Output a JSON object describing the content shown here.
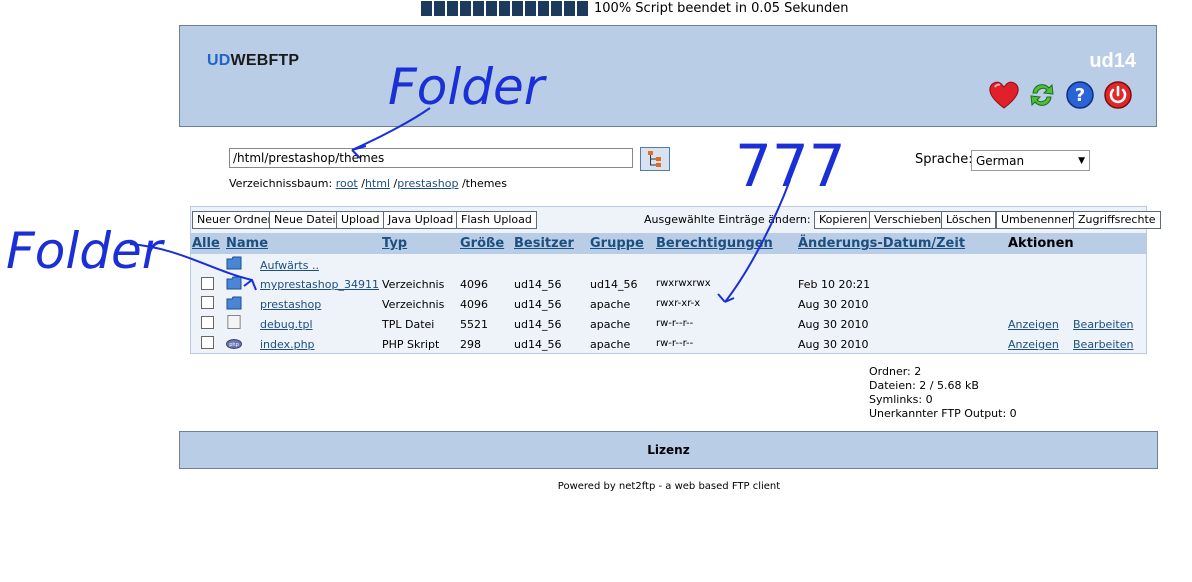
{
  "status": {
    "text": "100% Script beendet in 0.05 Sekunden",
    "progress_percent": 100,
    "segments": 13
  },
  "header": {
    "logo_prefix": "UD",
    "logo_suffix": "WEBFTP",
    "user": "ud14",
    "icons": [
      "heart-icon",
      "refresh-icon",
      "help-icon",
      "power-icon"
    ]
  },
  "path": {
    "value": "/html/prestashop/themes"
  },
  "language": {
    "label": "Sprache:",
    "selected": "German"
  },
  "breadcrumb": {
    "label": "Verzeichnissbaum:",
    "root": "root",
    "sep1": " /",
    "html": "html",
    "sep2": " /",
    "prestashop": "prestashop",
    "tail": " /themes"
  },
  "toolbar": {
    "new_folder": "Neuer Ordner",
    "new_file": "Neue Datei",
    "upload": "Upload",
    "java_upload": "Java Upload",
    "flash_upload": "Flash Upload",
    "selection_label": "Ausgewählte Einträge ändern:",
    "copy": "Kopieren",
    "move": "Verschieben",
    "delete": "Löschen",
    "rename": "Umbenennen",
    "permissions": "Zugriffsrechte"
  },
  "columns": {
    "all": "Alle",
    "name": "Name",
    "type": "Typ",
    "size": "Größe",
    "owner": "Besitzer",
    "group": "Gruppe",
    "perms": "Berechtigungen",
    "date": "Änderungs-Datum/Zeit",
    "actions": "Aktionen"
  },
  "up_link": "Aufwärts ..",
  "rows": [
    {
      "name": "myprestashop_34911",
      "type": "Verzeichnis",
      "size": "4096",
      "owner": "ud14_56",
      "group": "ud14_56",
      "perms": "rwxrwxrwx",
      "date": "Feb 10 20:21",
      "view": "",
      "edit": ""
    },
    {
      "name": "prestashop",
      "type": "Verzeichnis",
      "size": "4096",
      "owner": "ud14_56",
      "group": "apache",
      "perms": "rwxr-xr-x",
      "date": "Aug 30 2010",
      "view": "",
      "edit": ""
    },
    {
      "name": "debug.tpl",
      "type": "TPL Datei",
      "size": "5521",
      "owner": "ud14_56",
      "group": "apache",
      "perms": "rw-r--r--",
      "date": "Aug 30 2010",
      "view": "Anzeigen",
      "edit": "Bearbeiten"
    },
    {
      "name": "index.php",
      "type": "PHP Skript",
      "size": "298",
      "owner": "ud14_56",
      "group": "apache",
      "perms": "rw-r--r--",
      "date": "Aug 30 2010",
      "view": "Anzeigen",
      "edit": "Bearbeiten"
    }
  ],
  "stats": {
    "folders": "Ordner: 2",
    "files": "Dateien: 2 / 5.68 kB",
    "symlinks": "Symlinks: 0",
    "unknown": "Unerkannter FTP Output: 0"
  },
  "footer": {
    "license": "Lizenz",
    "powered": "Powered by net2ftp - a web based FTP client"
  },
  "annotations": {
    "folder_top": "Folder",
    "folder_left": "Folder",
    "perms_note": "777"
  },
  "colors": {
    "accent": "#b9cde6",
    "link": "#1c4f80",
    "annotation": "#1a2fd6"
  }
}
